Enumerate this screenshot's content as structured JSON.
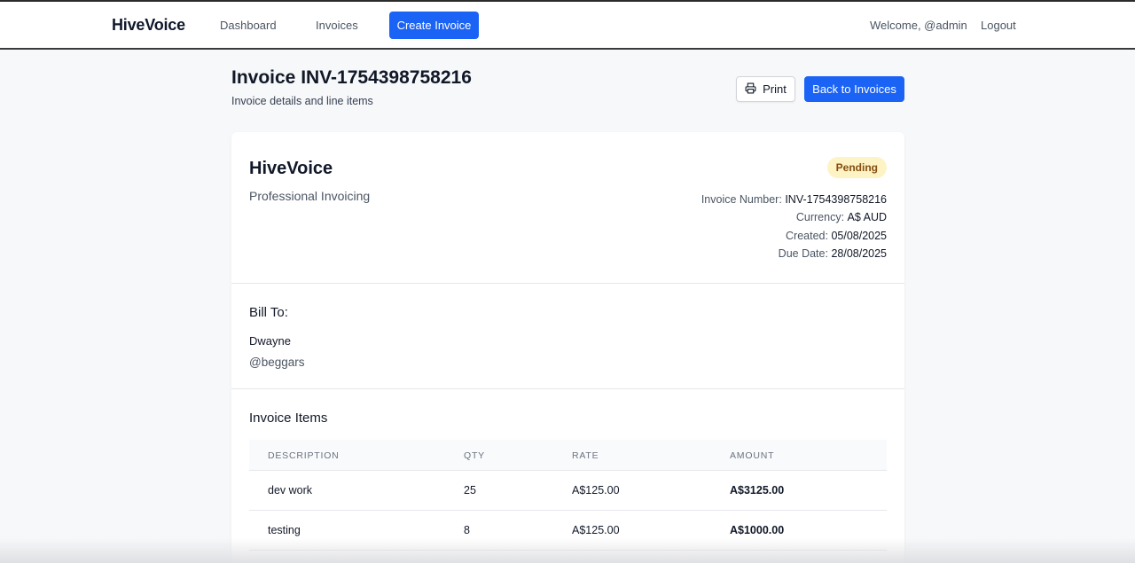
{
  "nav": {
    "brand": "HiveVoice",
    "links": [
      {
        "label": "Dashboard"
      },
      {
        "label": "Invoices"
      }
    ],
    "create_label": "Create Invoice",
    "welcome": "Welcome, @admin",
    "logout": "Logout"
  },
  "header": {
    "title": "Invoice INV-1754398758216",
    "subtitle": "Invoice details and line items",
    "print_label": "Print",
    "back_label": "Back to Invoices"
  },
  "invoice": {
    "company_name": "HiveVoice",
    "company_tagline": "Professional Invoicing",
    "status": "Pending",
    "status_color": "#fdf3c4",
    "meta": [
      {
        "label": "Invoice Number:",
        "value": "INV-1754398758216"
      },
      {
        "label": "Currency:",
        "value": "A$ AUD"
      },
      {
        "label": "Created:",
        "value": "05/08/2025"
      },
      {
        "label": "Due Date:",
        "value": "28/08/2025"
      }
    ],
    "bill_to": {
      "heading": "Bill To:",
      "name": "Dwayne",
      "handle": "@beggars"
    },
    "items_heading": "Invoice Items",
    "columns": [
      "DESCRIPTION",
      "QTY",
      "RATE",
      "AMOUNT"
    ],
    "items": [
      {
        "description": "dev work",
        "qty": "25",
        "rate": "A$125.00",
        "amount": "A$3125.00"
      },
      {
        "description": "testing",
        "qty": "8",
        "rate": "A$125.00",
        "amount": "A$1000.00"
      }
    ]
  },
  "colors": {
    "accent": "#1a63f5",
    "background": "#f7f8fa"
  }
}
